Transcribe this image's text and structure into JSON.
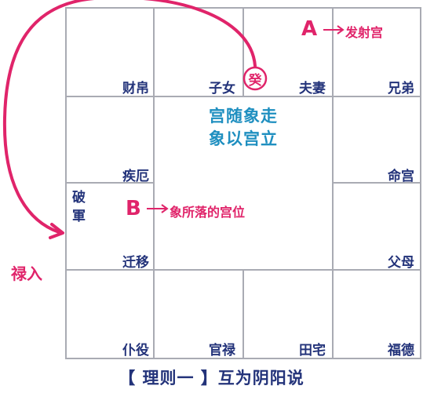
{
  "palaces": {
    "caibo": "财帛",
    "zinv": "子女",
    "fuqi": "夫妻",
    "xiongdi": "兄弟",
    "jie": "疾厄",
    "ming": "命宫",
    "qianyi": "迁移",
    "fumu": "父母",
    "puyi": "仆役",
    "guanlu": "官禄",
    "tianzhai": "田宅",
    "fude": "福德"
  },
  "center": {
    "line1": "宫随象走",
    "line2": "象以宫立"
  },
  "stem": "癸",
  "star": "破軍",
  "label_a": "A",
  "label_a_text": "发射宫",
  "label_b": "B",
  "label_b_text": "象所落的宫位",
  "lu_ru": "禄入",
  "caption": "【 理则一 】互为阴阳说",
  "colors": {
    "grid": "#a9abb3",
    "text": "#23337a",
    "accent": "#e0246a",
    "center": "#1f8fc0"
  }
}
